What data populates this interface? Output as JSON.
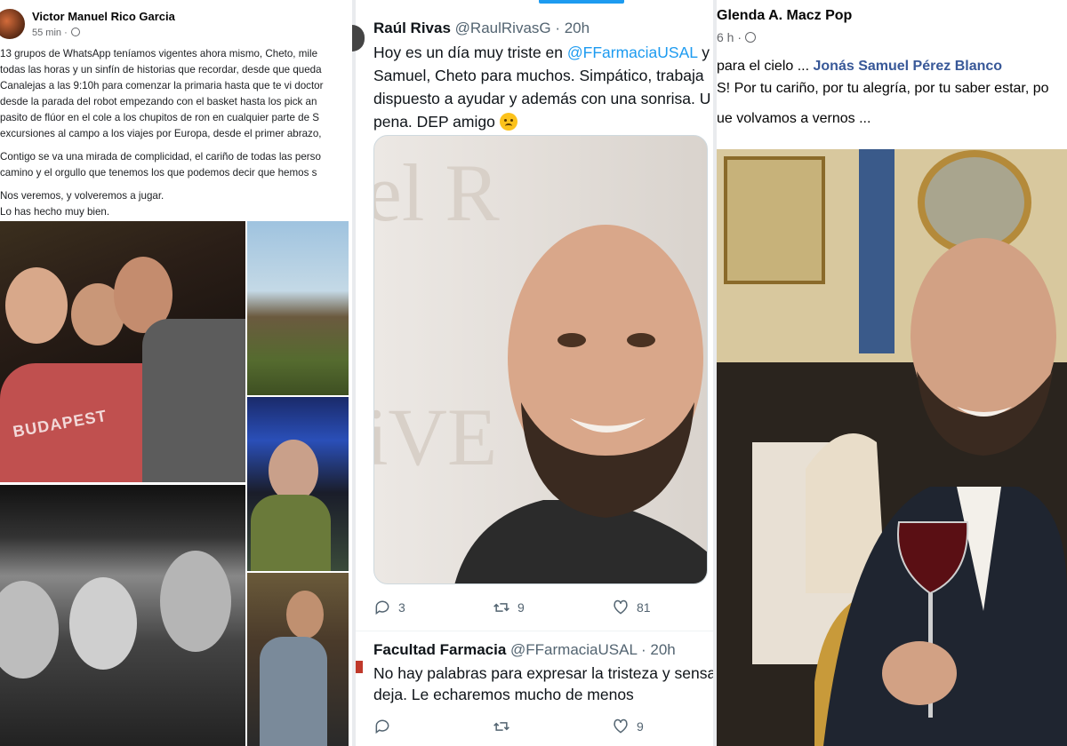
{
  "left_post": {
    "author": "Victor Manuel Rico Garcia",
    "time": "55 min ·",
    "lines": [
      "13 grupos de WhatsApp teníamos vigentes ahora mismo, Cheto, mile",
      "todas las horas y un sinfín de historias que recordar, desde que queda",
      "Canalejas a las 9:10h para comenzar la primaria hasta que te vi doctor",
      "desde la parada del robot empezando con el basket hasta los pick an",
      "pasito de flúor en el cole a los chupitos de ron en cualquier parte de S",
      "excursiones al campo a los viajes por Europa, desde el primer abrazo,"
    ],
    "lines2": [
      "Contigo se va una mirada de complicidad, el cariño de todas las perso",
      "camino y el orgullo que tenemos los que podemos decir que hemos s"
    ],
    "lines3": [
      "Nos veremos, y volveremos a jugar.",
      "Lo has hecho muy bien."
    ],
    "shirt_text": "BUDAPEST"
  },
  "middle_tweet": {
    "author": "Raúl Rivas",
    "handle": "@RaulRivasG · 20h",
    "line1_pre": "Hoy es un día muy triste en ",
    "line1_mention": "@FFarmaciaUSAL",
    "line1_post": " y ",
    "line1_mention2": "@",
    "line2": "Samuel, Cheto para muchos. Simpático, trabaja",
    "line3": "dispuesto a ayudar y además con una sonrisa. U",
    "line4": "pena. DEP amigo ",
    "replies": "3",
    "retweets": "9",
    "likes": "81"
  },
  "second_tweet": {
    "author": "Facultad Farmacia",
    "handle": "@FFarmaciaUSAL · 20h",
    "line1": "No hay palabras para expresar la tristeza y sensa",
    "line2": "deja. Le echaremos mucho de menos",
    "likes": "9"
  },
  "right_post": {
    "author": "Glenda A. Macz Pop",
    "time": "6 h ·",
    "line1_pre": "para el cielo ... ",
    "line1_link": "Jonás Samuel Pérez Blanco",
    "line2": "S! Por tu cariño, por tu alegría, por tu saber estar, po",
    "line3": "ue volvamos a vernos ..."
  },
  "colors": {
    "twitter_blue": "#1d9bf0",
    "fb_link": "#385898"
  }
}
